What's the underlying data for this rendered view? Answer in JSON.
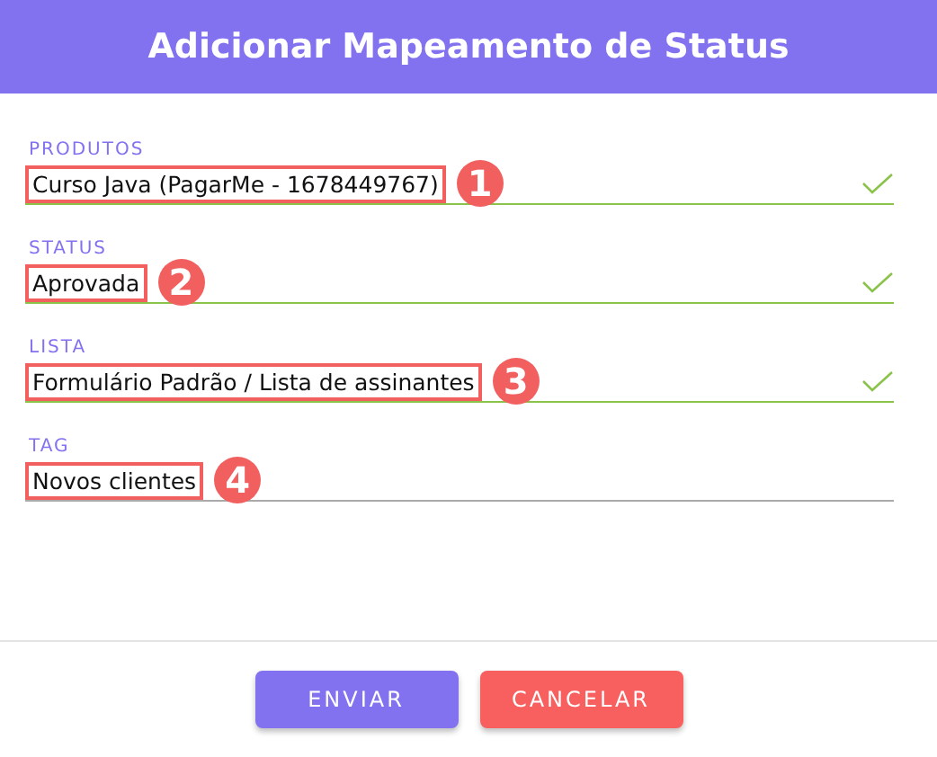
{
  "dialog": {
    "title": "Adicionar Mapeamento de Status"
  },
  "fields": [
    {
      "label": "PRODUTOS",
      "value": "Curso Java (PagarMe - 1678449767)",
      "valid": true,
      "marker": "1"
    },
    {
      "label": "STATUS",
      "value": "Aprovada",
      "valid": true,
      "marker": "2"
    },
    {
      "label": "LISTA",
      "value": "Formulário Padrão / Lista de assinantes",
      "valid": true,
      "marker": "3"
    },
    {
      "label": "TAG",
      "value": "Novos clientes",
      "valid": false,
      "marker": "4"
    }
  ],
  "buttons": [
    {
      "label": "ENVIAR",
      "kind": "primary"
    },
    {
      "label": "CANCELAR",
      "kind": "danger"
    }
  ]
}
